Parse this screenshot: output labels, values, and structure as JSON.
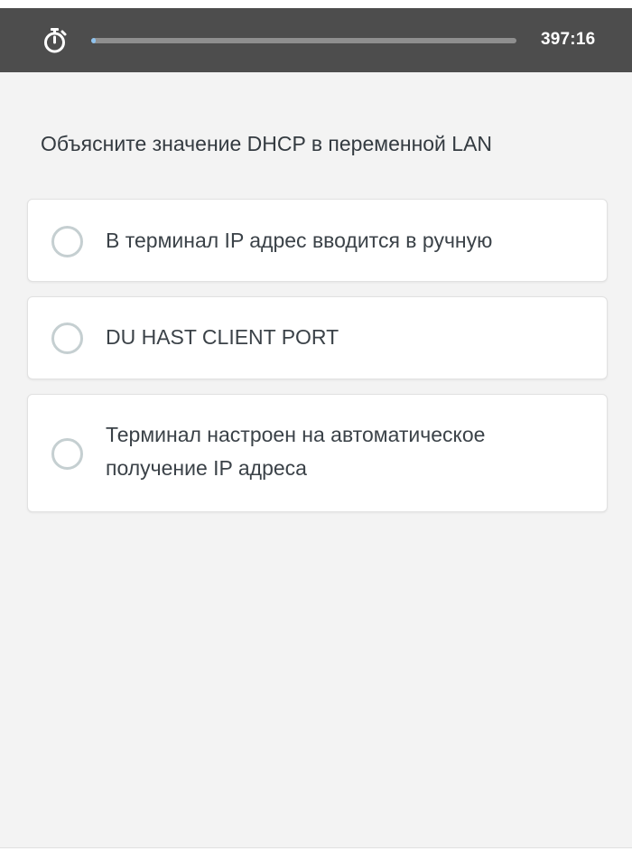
{
  "timer": {
    "icon": "stopwatch-icon",
    "time_left": "397:16",
    "progress_fraction": 0.01,
    "progress_color": "#8ec3ef"
  },
  "question": {
    "text": "Объясните значение DHCP в переменной LAN"
  },
  "options": [
    {
      "label": "В терминал IP адрес вводится  в ручную"
    },
    {
      "label": "DU HAST CLIENT PORT"
    },
    {
      "label": "Терминал настроен на автоматическое получение  IP адреса"
    }
  ],
  "colors": {
    "topbar": "#4d4d4d",
    "background": "#f3f3f3",
    "card": "#ffffff",
    "radio_border": "#c5cfd1",
    "text": "#333a40"
  }
}
